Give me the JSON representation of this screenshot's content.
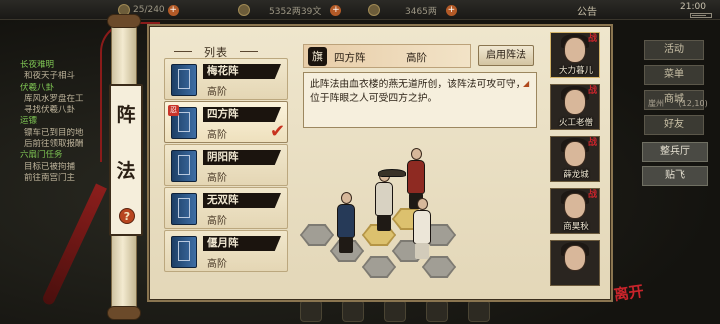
{
  "topbar": {
    "stamina": "25/240",
    "silver": "5352两39文",
    "gold": "3465两",
    "notice": "公告",
    "time": "21:00"
  },
  "quest_log": [
    {
      "text": "长夜难明",
      "style": "hd"
    },
    {
      "text": "和夜天子相斗"
    },
    {
      "text": "伏羲八卦",
      "style": "hd"
    },
    {
      "text": "库风水罗盘在工"
    },
    {
      "text": "寻找伏羲八卦"
    },
    {
      "text": "运镖",
      "style": "hd"
    },
    {
      "text": "镖车已到目的地"
    },
    {
      "text": "后前往领取报酬"
    },
    {
      "text": "六扇门任务",
      "style": "hd"
    },
    {
      "text": "目标已被拘捕"
    },
    {
      "text": "前往南宫门主"
    }
  ],
  "side_menu": [
    "活动",
    "菜单",
    "商城",
    "好友"
  ],
  "area_label": "崖州",
  "area_coord": "(12,10)",
  "right_buttons": [
    "整兵厅",
    "贴飞"
  ],
  "window": {
    "tab_title_top": "阵",
    "tab_title_bottom": "法",
    "help": "?",
    "list_header": "列表"
  },
  "formations": [
    {
      "name": "梅花阵",
      "level": "高阶",
      "selected": false
    },
    {
      "name": "四方阵",
      "level": "高阶",
      "selected": true,
      "tag": "忍"
    },
    {
      "name": "阴阳阵",
      "level": "高阶",
      "selected": false
    },
    {
      "name": "无双阵",
      "level": "高阶",
      "selected": false
    },
    {
      "name": "偃月阵",
      "level": "高阶",
      "selected": false
    }
  ],
  "detail": {
    "flag": "旗",
    "name": "四方阵",
    "level": "高阶",
    "enable_button": "启用阵法",
    "description": "此阵法由血衣楼的燕无道所创，该阵法可攻可守，位于阵眼之人可受四方之护。"
  },
  "roster": [
    {
      "name": "大力暮儿",
      "mark": "战"
    },
    {
      "name": "火工老僧",
      "mark": "战"
    },
    {
      "name": "薛龙城",
      "mark": "战"
    },
    {
      "name": "商昊秋",
      "mark": "战"
    },
    {
      "name": "",
      "mark": ""
    }
  ],
  "seal": "离开",
  "colors": {
    "paper": "#e9dfc4",
    "accent_red": "#c8242b",
    "ink": "#1b140e",
    "book_blue": "#2f5a8c",
    "hex_gold": "#dcc16e"
  }
}
